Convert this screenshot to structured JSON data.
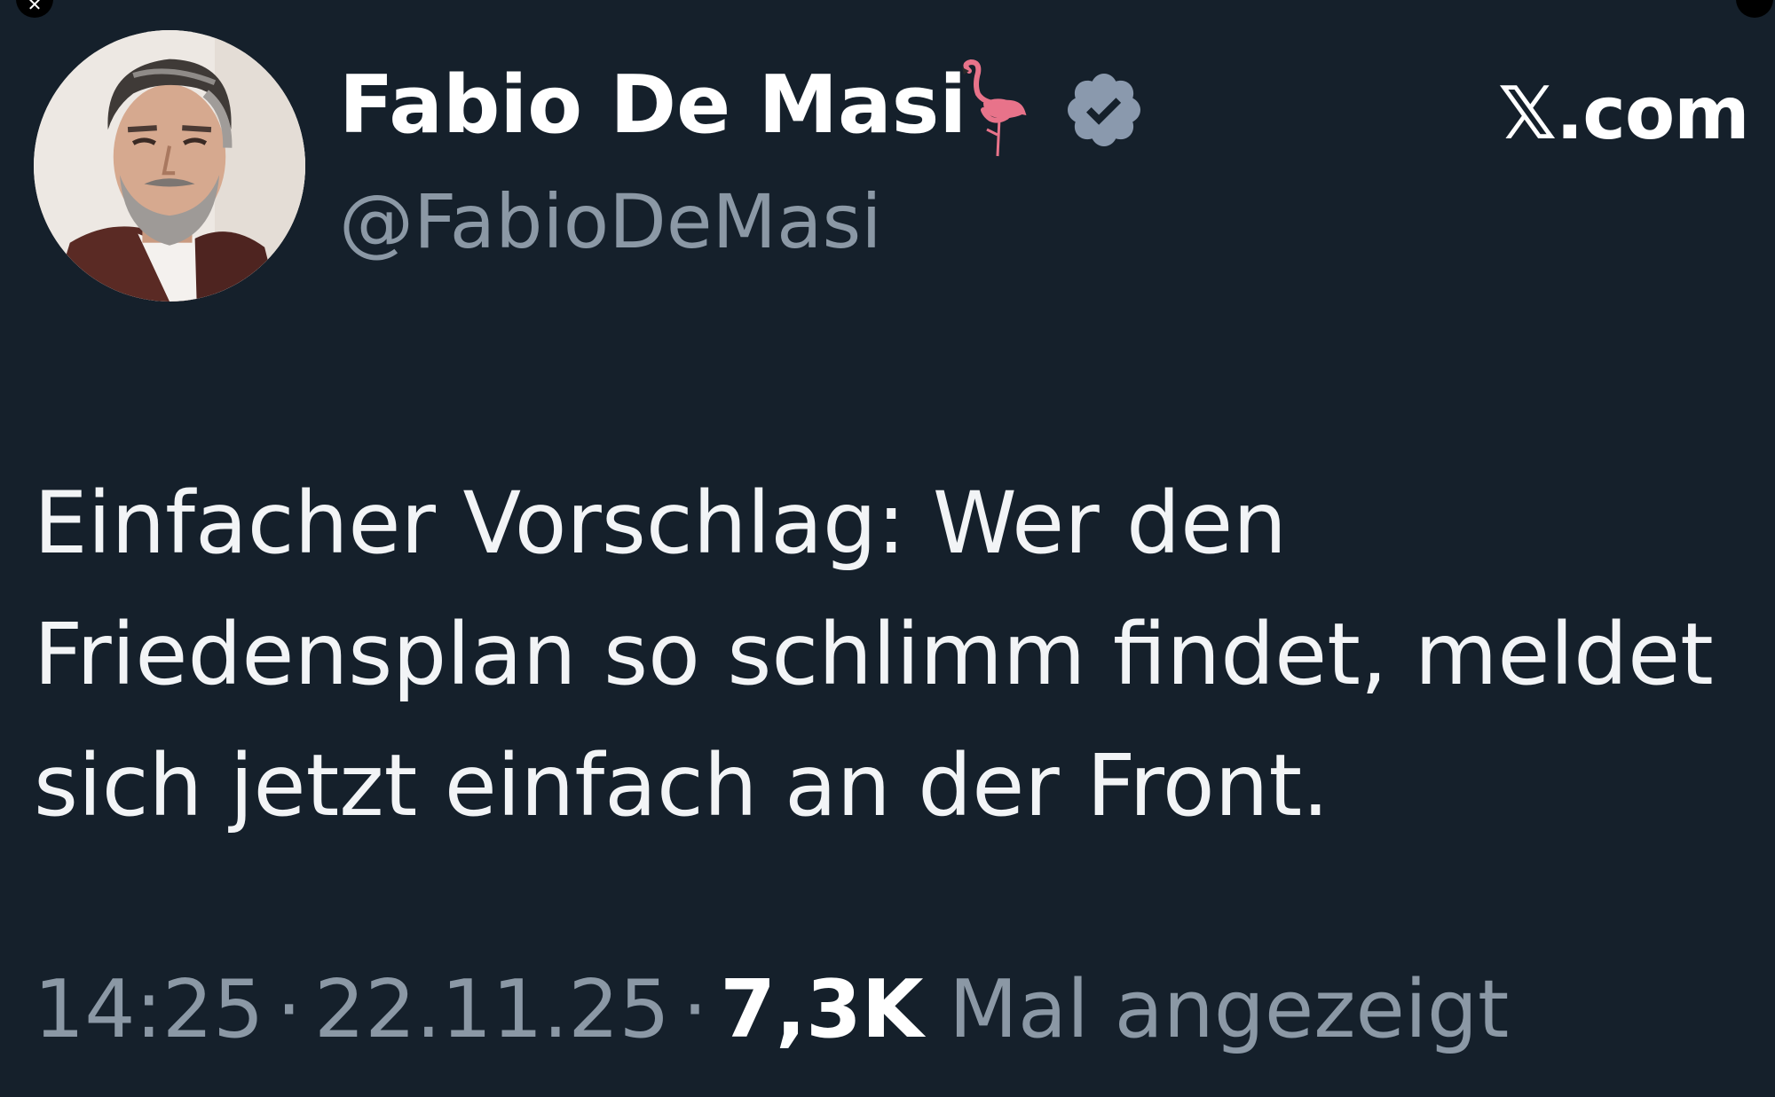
{
  "author": {
    "display_name": "Fabio De Masi",
    "handle": "@FabioDeMasi",
    "emoji_icon": "flamingo-icon",
    "verified_icon": "verified-badge-icon"
  },
  "site_label": "𝕏.com",
  "tweet": {
    "lines": [
      "Einfacher Vorschlag: Wer den",
      "Friedensplan so schlimm findet, meldet",
      "sich jetzt einfach an der Front."
    ]
  },
  "meta": {
    "time": "14:25",
    "separator": "·",
    "date": "22.11.25",
    "views_count": "7,3K",
    "views_label": "Mal angezeigt"
  },
  "colors": {
    "background": "#15202b",
    "text_primary": "#ffffff",
    "text_secondary": "#8b98a5",
    "verified_badge": "#8a99ad"
  }
}
